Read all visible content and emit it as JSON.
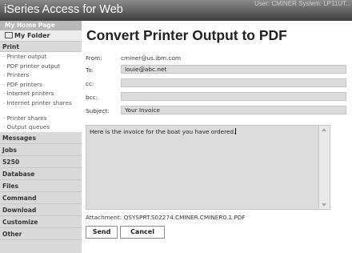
{
  "app": {
    "title": "iSeries Access for Web",
    "user_info": "User: CMINER   System: LP11UT..."
  },
  "sidebar": {
    "home": "My Home Page",
    "folder": "My Folder",
    "print_section": "Print",
    "print_items": [
      "Printer output",
      "PDF printer output",
      "Printers",
      "PDF printers",
      "Internet printers",
      "Internet printer shares",
      "Printer shares",
      "Output queues"
    ],
    "sections": [
      "Messages",
      "Jobs",
      "5250",
      "Database",
      "Files",
      "Command",
      "Download",
      "Customize",
      "Other"
    ]
  },
  "page": {
    "title": "Convert Printer Output to PDF"
  },
  "form": {
    "from_label": "From:",
    "from_value": "cminer@us.ibm.com",
    "to_label": "To:",
    "to_value": "louie@abc.net",
    "cc_label": "cc:",
    "cc_value": "",
    "bcc_label": "bcc:",
    "bcc_value": "",
    "subject_label": "Subject:",
    "subject_value": "Your Invoice",
    "message": "Here is the invoice for the boat you have ordered.",
    "attachment_label": "Attachment:",
    "attachment_value": "QSYSPRT.S02274.CMINER.CMINER0.1.PDF"
  },
  "buttons": {
    "send": "Send",
    "cancel": "Cancel"
  },
  "colors": {
    "topbar": "#3e3e3e",
    "sidebar_bg": "#d9d9d9",
    "field_bg": "#dcdcdc"
  }
}
